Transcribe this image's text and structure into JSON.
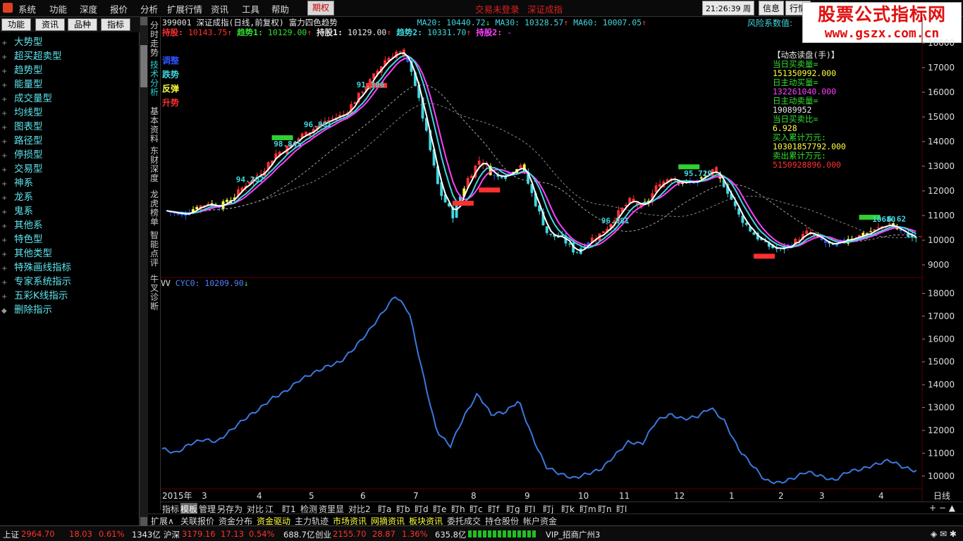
{
  "menubar": {
    "items": [
      "系统",
      "功能",
      "深度",
      "报价",
      "分析",
      "扩展行情",
      "资讯",
      "工具",
      "帮助"
    ],
    "options_button": "期权",
    "warnings": [
      "交易未登录",
      "深证成指"
    ],
    "clock": "21:26:39 周二",
    "right_buttons": [
      "信息",
      "行情"
    ]
  },
  "brand": {
    "line1": "股票公式指标网",
    "line2": "www.gszx.com.cn"
  },
  "leftpanel": {
    "tabs": [
      "功能",
      "资讯",
      "品种",
      "指标"
    ],
    "tree": [
      {
        "pm": "+",
        "label": "大势型"
      },
      {
        "pm": "+",
        "label": "超买超卖型"
      },
      {
        "pm": "+",
        "label": "趋势型"
      },
      {
        "pm": "+",
        "label": "能量型"
      },
      {
        "pm": "+",
        "label": "成交量型"
      },
      {
        "pm": "+",
        "label": "均线型"
      },
      {
        "pm": "+",
        "label": "图表型"
      },
      {
        "pm": "+",
        "label": "路径型"
      },
      {
        "pm": "+",
        "label": "停损型"
      },
      {
        "pm": "+",
        "label": "交易型"
      },
      {
        "pm": "+",
        "label": "神系"
      },
      {
        "pm": "+",
        "label": "龙系"
      },
      {
        "pm": "+",
        "label": "鬼系"
      },
      {
        "pm": "+",
        "label": "其他系"
      },
      {
        "pm": "+",
        "label": "特色型"
      },
      {
        "pm": "+",
        "label": "其他类型"
      },
      {
        "pm": "+",
        "label": "特殊画线指标"
      },
      {
        "pm": "+",
        "label": "专家系统指示"
      },
      {
        "pm": "+",
        "label": "五彩K线指示"
      },
      {
        "pm": "◆",
        "label": "删除指示"
      }
    ]
  },
  "vtabs": [
    {
      "label": "分时走势",
      "active": false
    },
    {
      "label": "技术分析",
      "active": true
    },
    {
      "label": "基本资料",
      "active": false
    },
    {
      "label": "东财深度",
      "active": false
    },
    {
      "label": "龙虎榜单",
      "active": false
    },
    {
      "label": "智能点评",
      "active": false
    },
    {
      "label": "牛叉诊断",
      "active": false
    }
  ],
  "header": {
    "code": "399001",
    "name": "深证成指(日线,前复权)",
    "formula": "富力四色趋势",
    "ma20": "MA20: 10440.72",
    "ma30": "MA30: 10328.57",
    "ma60": "MA60: 10007.05",
    "row2": [
      {
        "label": "持股:",
        "value": "10143.75",
        "color": "c-r"
      },
      {
        "label": "趋势1:",
        "value": "10129.00",
        "color": "c-g"
      },
      {
        "label": "持股1:",
        "value": "10129.00",
        "color": "c-w"
      },
      {
        "label": "趋势2:",
        "value": "10331.70",
        "color": "c-c"
      },
      {
        "label": "持股2:",
        "value": "-",
        "color": "c-m"
      }
    ],
    "risk": "风险系数值:"
  },
  "legend4": [
    {
      "label": "调整",
      "color": "#2a55ff"
    },
    {
      "label": "跌势",
      "color": "#40d8e0"
    },
    {
      "label": "反弹",
      "color": "#ffff40"
    },
    {
      "label": "升势",
      "color": "#ff3030"
    }
  ],
  "dynamic": [
    {
      "t": "【动态读盘(手)】",
      "c": "c-w"
    },
    {
      "t": "当日买卖量=",
      "c": "c-g"
    },
    {
      "t": "151350992.000",
      "c": "c-y"
    },
    {
      "t": "日主动买量=",
      "c": "c-g"
    },
    {
      "t": "132261040.000",
      "c": "c-m"
    },
    {
      "t": "日主动卖量=",
      "c": "c-g"
    },
    {
      "t": "19089952",
      "c": "c-w"
    },
    {
      "t": "当日买卖比=",
      "c": "c-g"
    },
    {
      "t": "6.928",
      "c": "c-y"
    },
    {
      "t": "买入累计万元:",
      "c": "c-g"
    },
    {
      "t": "10301857792.000",
      "c": "c-y"
    },
    {
      "t": "卖出累计万元:",
      "c": "c-g"
    },
    {
      "t": "5150928896.000",
      "c": "c-r"
    }
  ],
  "chart_data": [
    {
      "type": "candlestick",
      "title": "深证成指(日线,前复权) 富力四色趋势",
      "y_ticks": [
        9000,
        10000,
        11000,
        12000,
        13000,
        14000,
        15000,
        16000,
        17000,
        18000
      ],
      "ylim": [
        8600,
        18200
      ],
      "trend_labels": [
        "94.207",
        "98.845",
        "96.861",
        "91.306",
        "95.729",
        "96.881",
        "10680",
        "6.62"
      ],
      "series": [
        {
          "name": "CLOSE",
          "values": [
            11200,
            11000,
            11300,
            11500,
            11400,
            11800,
            12400,
            12800,
            13500,
            13800,
            14300,
            14600,
            14900,
            15100,
            15800,
            16500,
            17300,
            17700,
            16900,
            14500,
            12000,
            11000,
            12400,
            13300,
            12600,
            12700,
            13100,
            11600,
            10200,
            10100,
            9500,
            10000,
            10300,
            11000,
            11600,
            11300,
            12200,
            12600,
            12300,
            12400,
            12800,
            12200,
            11000,
            10300,
            9800,
            9600,
            9900,
            10300,
            10000,
            9700,
            10100,
            10200,
            10400,
            10700,
            10300,
            10100
          ]
        }
      ]
    },
    {
      "type": "line",
      "title": "VV CYC0: 10209.90",
      "y_ticks": [
        10000,
        11000,
        12000,
        13000,
        14000,
        15000,
        16000,
        17000,
        18000
      ],
      "ylim": [
        9500,
        18200
      ],
      "x_ticks": [
        "2015年",
        "3",
        "4",
        "5",
        "6",
        "7",
        "8",
        "9",
        "10",
        "11",
        "12",
        "1",
        "2",
        "3",
        "4"
      ],
      "x_unit": "日线",
      "series": [
        {
          "name": "CYC0",
          "values": [
            11200,
            11000,
            11400,
            11600,
            11500,
            12000,
            12500,
            12900,
            13400,
            13700,
            14200,
            14500,
            14800,
            15000,
            15600,
            16300,
            17100,
            17900,
            17200,
            14500,
            12000,
            11300,
            12600,
            13600,
            12700,
            12800,
            13300,
            11700,
            10400,
            10100,
            9900,
            10100,
            10300,
            10900,
            11500,
            11400,
            12400,
            12700,
            12500,
            12600,
            13000,
            12400,
            11200,
            10500,
            9800,
            9700,
            9900,
            10200,
            10000,
            9800,
            10200,
            10300,
            10500,
            10700,
            10400,
            10210
          ]
        }
      ]
    }
  ],
  "subchart": {
    "name": "VV",
    "label": "CYC0: 10209.90"
  },
  "bottombar1": {
    "items": [
      "指标",
      "模板",
      "管理",
      "另存为",
      "对比",
      "江",
      "盯1",
      "检测",
      "资里显",
      "对比2",
      "盯a",
      "盯b",
      "盯d",
      "盯e",
      "盯h",
      "盯c",
      "盯f",
      "盯g",
      "盯I",
      "盯j",
      "盯k",
      "盯m",
      "盯n",
      "盯l"
    ],
    "active": "模板",
    "right": "+ − ▲"
  },
  "bottombar2": {
    "items": [
      {
        "t": "扩展∧",
        "hl": false
      },
      {
        "t": "关联报价",
        "hl": false
      },
      {
        "t": "资金分布",
        "hl": false
      },
      {
        "t": "资金驱动",
        "hl": true
      },
      {
        "t": "主力轨迹",
        "hl": false
      },
      {
        "t": "市场资讯",
        "hl": true
      },
      {
        "t": "网摘资讯",
        "hl": true
      },
      {
        "t": "板块资讯",
        "hl": true
      },
      {
        "t": "委托成交",
        "hl": false
      },
      {
        "t": "持仓股份",
        "hl": false
      },
      {
        "t": "帐户资金",
        "hl": false
      }
    ]
  },
  "status": {
    "sh_label": "上证",
    "sh_price": "2964.70",
    "sh_chg": "18.03",
    "sh_pct": "0.61%",
    "sh_vol": "1343亿",
    "hs_label": "沪深",
    "hs_price": "3179.16",
    "hs_chg": "17.13",
    "hs_pct": "0.54%",
    "hs_vol": "688.7亿",
    "cy_label": "创业",
    "cy_price": "2155.70",
    "cy_chg": "28.87",
    "cy_pct": "1.36%",
    "cy_vol": "635.8亿",
    "broker": "VIP_招商广州3"
  },
  "colors": {
    "up": "#ff3030",
    "down": "#40d8e0",
    "ma": "#e8e8e8",
    "line": "#3a78e0",
    "grid": "#3a0000"
  }
}
